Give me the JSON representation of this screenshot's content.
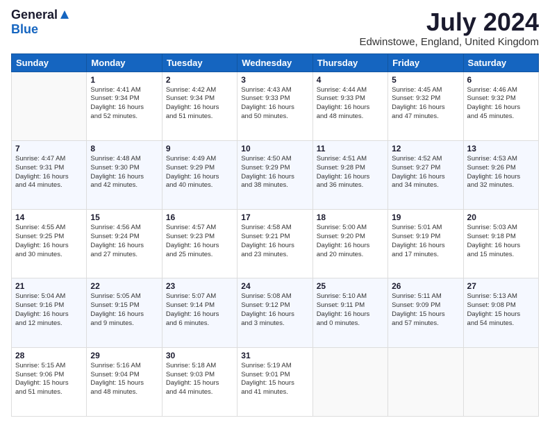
{
  "logo": {
    "general": "General",
    "blue": "Blue"
  },
  "title": "July 2024",
  "subtitle": "Edwinstowe, England, United Kingdom",
  "days_of_week": [
    "Sunday",
    "Monday",
    "Tuesday",
    "Wednesday",
    "Thursday",
    "Friday",
    "Saturday"
  ],
  "weeks": [
    [
      {
        "day": "",
        "info": ""
      },
      {
        "day": "1",
        "info": "Sunrise: 4:41 AM\nSunset: 9:34 PM\nDaylight: 16 hours\nand 52 minutes."
      },
      {
        "day": "2",
        "info": "Sunrise: 4:42 AM\nSunset: 9:34 PM\nDaylight: 16 hours\nand 51 minutes."
      },
      {
        "day": "3",
        "info": "Sunrise: 4:43 AM\nSunset: 9:33 PM\nDaylight: 16 hours\nand 50 minutes."
      },
      {
        "day": "4",
        "info": "Sunrise: 4:44 AM\nSunset: 9:33 PM\nDaylight: 16 hours\nand 48 minutes."
      },
      {
        "day": "5",
        "info": "Sunrise: 4:45 AM\nSunset: 9:32 PM\nDaylight: 16 hours\nand 47 minutes."
      },
      {
        "day": "6",
        "info": "Sunrise: 4:46 AM\nSunset: 9:32 PM\nDaylight: 16 hours\nand 45 minutes."
      }
    ],
    [
      {
        "day": "7",
        "info": "Sunrise: 4:47 AM\nSunset: 9:31 PM\nDaylight: 16 hours\nand 44 minutes."
      },
      {
        "day": "8",
        "info": "Sunrise: 4:48 AM\nSunset: 9:30 PM\nDaylight: 16 hours\nand 42 minutes."
      },
      {
        "day": "9",
        "info": "Sunrise: 4:49 AM\nSunset: 9:29 PM\nDaylight: 16 hours\nand 40 minutes."
      },
      {
        "day": "10",
        "info": "Sunrise: 4:50 AM\nSunset: 9:29 PM\nDaylight: 16 hours\nand 38 minutes."
      },
      {
        "day": "11",
        "info": "Sunrise: 4:51 AM\nSunset: 9:28 PM\nDaylight: 16 hours\nand 36 minutes."
      },
      {
        "day": "12",
        "info": "Sunrise: 4:52 AM\nSunset: 9:27 PM\nDaylight: 16 hours\nand 34 minutes."
      },
      {
        "day": "13",
        "info": "Sunrise: 4:53 AM\nSunset: 9:26 PM\nDaylight: 16 hours\nand 32 minutes."
      }
    ],
    [
      {
        "day": "14",
        "info": "Sunrise: 4:55 AM\nSunset: 9:25 PM\nDaylight: 16 hours\nand 30 minutes."
      },
      {
        "day": "15",
        "info": "Sunrise: 4:56 AM\nSunset: 9:24 PM\nDaylight: 16 hours\nand 27 minutes."
      },
      {
        "day": "16",
        "info": "Sunrise: 4:57 AM\nSunset: 9:23 PM\nDaylight: 16 hours\nand 25 minutes."
      },
      {
        "day": "17",
        "info": "Sunrise: 4:58 AM\nSunset: 9:21 PM\nDaylight: 16 hours\nand 23 minutes."
      },
      {
        "day": "18",
        "info": "Sunrise: 5:00 AM\nSunset: 9:20 PM\nDaylight: 16 hours\nand 20 minutes."
      },
      {
        "day": "19",
        "info": "Sunrise: 5:01 AM\nSunset: 9:19 PM\nDaylight: 16 hours\nand 17 minutes."
      },
      {
        "day": "20",
        "info": "Sunrise: 5:03 AM\nSunset: 9:18 PM\nDaylight: 16 hours\nand 15 minutes."
      }
    ],
    [
      {
        "day": "21",
        "info": "Sunrise: 5:04 AM\nSunset: 9:16 PM\nDaylight: 16 hours\nand 12 minutes."
      },
      {
        "day": "22",
        "info": "Sunrise: 5:05 AM\nSunset: 9:15 PM\nDaylight: 16 hours\nand 9 minutes."
      },
      {
        "day": "23",
        "info": "Sunrise: 5:07 AM\nSunset: 9:14 PM\nDaylight: 16 hours\nand 6 minutes."
      },
      {
        "day": "24",
        "info": "Sunrise: 5:08 AM\nSunset: 9:12 PM\nDaylight: 16 hours\nand 3 minutes."
      },
      {
        "day": "25",
        "info": "Sunrise: 5:10 AM\nSunset: 9:11 PM\nDaylight: 16 hours\nand 0 minutes."
      },
      {
        "day": "26",
        "info": "Sunrise: 5:11 AM\nSunset: 9:09 PM\nDaylight: 15 hours\nand 57 minutes."
      },
      {
        "day": "27",
        "info": "Sunrise: 5:13 AM\nSunset: 9:08 PM\nDaylight: 15 hours\nand 54 minutes."
      }
    ],
    [
      {
        "day": "28",
        "info": "Sunrise: 5:15 AM\nSunset: 9:06 PM\nDaylight: 15 hours\nand 51 minutes."
      },
      {
        "day": "29",
        "info": "Sunrise: 5:16 AM\nSunset: 9:04 PM\nDaylight: 15 hours\nand 48 minutes."
      },
      {
        "day": "30",
        "info": "Sunrise: 5:18 AM\nSunset: 9:03 PM\nDaylight: 15 hours\nand 44 minutes."
      },
      {
        "day": "31",
        "info": "Sunrise: 5:19 AM\nSunset: 9:01 PM\nDaylight: 15 hours\nand 41 minutes."
      },
      {
        "day": "",
        "info": ""
      },
      {
        "day": "",
        "info": ""
      },
      {
        "day": "",
        "info": ""
      }
    ]
  ]
}
